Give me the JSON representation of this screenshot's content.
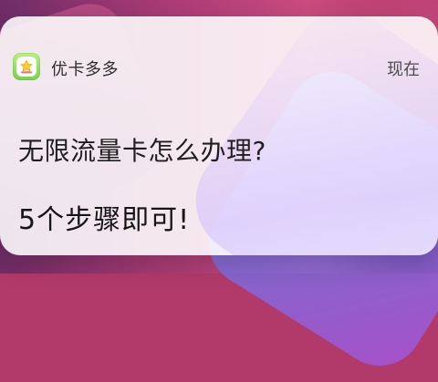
{
  "notification": {
    "app_name": "优卡多多",
    "time": "现在",
    "title": "无限流量卡怎么办理?",
    "message": "5个步骤即可!",
    "icon": "app-logo-icon"
  },
  "colors": {
    "card_background": "#ffffff",
    "icon_green": "#79d24a"
  }
}
